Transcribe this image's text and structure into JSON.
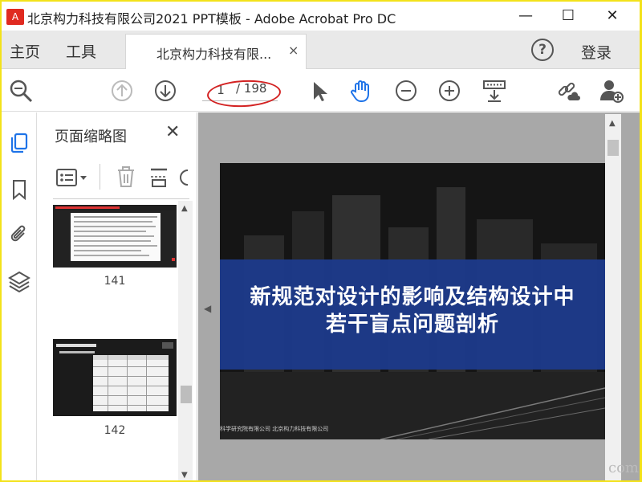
{
  "window": {
    "title": "北京构力科技有限公司2021 PPT模板 - Adobe Acrobat Pro DC",
    "minimize": "—",
    "maximize": "☐",
    "close": "✕"
  },
  "menu": {
    "home": "主页",
    "tools": "工具",
    "doc_tab": "北京构力科技有限...",
    "doc_tab_close": "×",
    "help": "?",
    "login": "登录"
  },
  "toolbar": {
    "current_page": "1",
    "total_pages": "/ 198",
    "icons": [
      "zoom-search-icon",
      "page-up-icon",
      "page-down-icon",
      "select-cursor-icon",
      "hand-tool-icon",
      "zoom-out-icon",
      "zoom-in-icon",
      "keyboard-scroll-icon",
      "share-link-icon",
      "add-user-icon"
    ]
  },
  "rail": {
    "icons": [
      "page-thumbnails-icon",
      "bookmark-icon",
      "attachment-icon",
      "layers-icon"
    ]
  },
  "thumbnails_panel": {
    "title": "页面缩略图",
    "close": "✕",
    "pages": [
      {
        "label": "141"
      },
      {
        "label": "142"
      }
    ]
  },
  "slide": {
    "line1": "新规范对设计的影响及结构设计中",
    "line2": "若干盲点问题剖析",
    "footer": "科学研究院有限公司 北京构力科技有限公司"
  },
  "watermark": "com",
  "colors": {
    "accent_blue": "#1c3a8b",
    "annotation_red": "#d32222",
    "hand_tool_blue": "#1e73e8"
  }
}
